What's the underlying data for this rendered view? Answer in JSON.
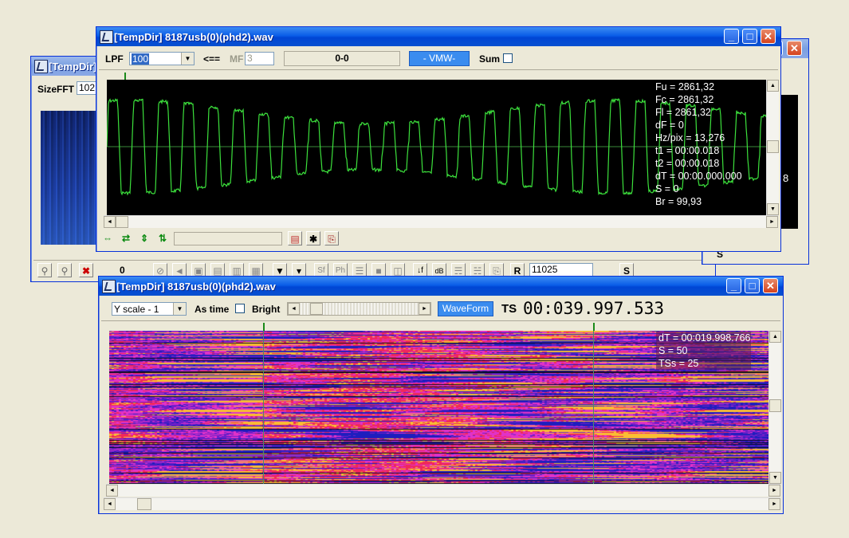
{
  "back_window": {
    "title": "[TempDir]",
    "sizefft_label": "SizeFFT",
    "sizefft_value": "102",
    "counter": "0",
    "rate_value": "11025",
    "r_button": "R",
    "s_button": "S",
    "side_digit": "8",
    "side_letter": "S"
  },
  "wave_window": {
    "title": "[TempDir] 8187usb(0)(phd2).wav",
    "lpf_label": "LPF",
    "lpf_value": "100",
    "arrow_label": "<==",
    "mf_label": "MF",
    "mf_value": "3",
    "range_panel": "0-0",
    "vmw_button": "- VMW-",
    "sum_label": "Sum",
    "readout": [
      "Fu = 2861,32",
      "Fc = 2861,32",
      "Fl = 2861,32",
      "dF = 0",
      "Hz/pix = 13,276",
      "t1 = 00:00.018",
      "t2 = 00:00.018",
      "dT = 00:00.000.000",
      "S = 0",
      "Br = 99,93"
    ],
    "colors": {
      "trace": "#3CE03C",
      "background": "#000000"
    }
  },
  "spec_window": {
    "title": "[TempDir] 8187usb(0)(phd2).wav",
    "yscale_value": "Y scale - 1",
    "astime_label": "As time",
    "bright_label": "Bright",
    "waveform_button": "WaveForm",
    "ts_label": "TS",
    "ts_value": "00:039.997.533",
    "readout": [
      "dT = 00:019.998.766",
      "S = 50",
      "TSs = 25"
    ]
  }
}
